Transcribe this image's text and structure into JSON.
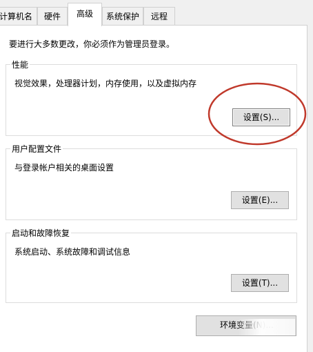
{
  "tabs": [
    {
      "label": "计算机名"
    },
    {
      "label": "硬件"
    },
    {
      "label": "高级"
    },
    {
      "label": "系统保护"
    },
    {
      "label": "远程"
    }
  ],
  "active_tab": "高级",
  "admin_notice": "要进行大多数更改，你必须作为管理员登录。",
  "performance": {
    "title": "性能",
    "description": "视觉效果，处理器计划，内存使用，以及虚拟内存",
    "button": "设置(S)..."
  },
  "user_profiles": {
    "title": "用户配置文件",
    "description": "与登录帐户相关的桌面设置",
    "button": "设置(E)..."
  },
  "startup_recovery": {
    "title": "启动和故障恢复",
    "description": "系统启动、系统故障和调试信息",
    "button": "设置(T)..."
  },
  "env_button": "环境变量(N)...",
  "colors": {
    "annotation": "#c0392b",
    "panel_bg": "#ffffff",
    "window_bg": "#f0f0f0"
  }
}
